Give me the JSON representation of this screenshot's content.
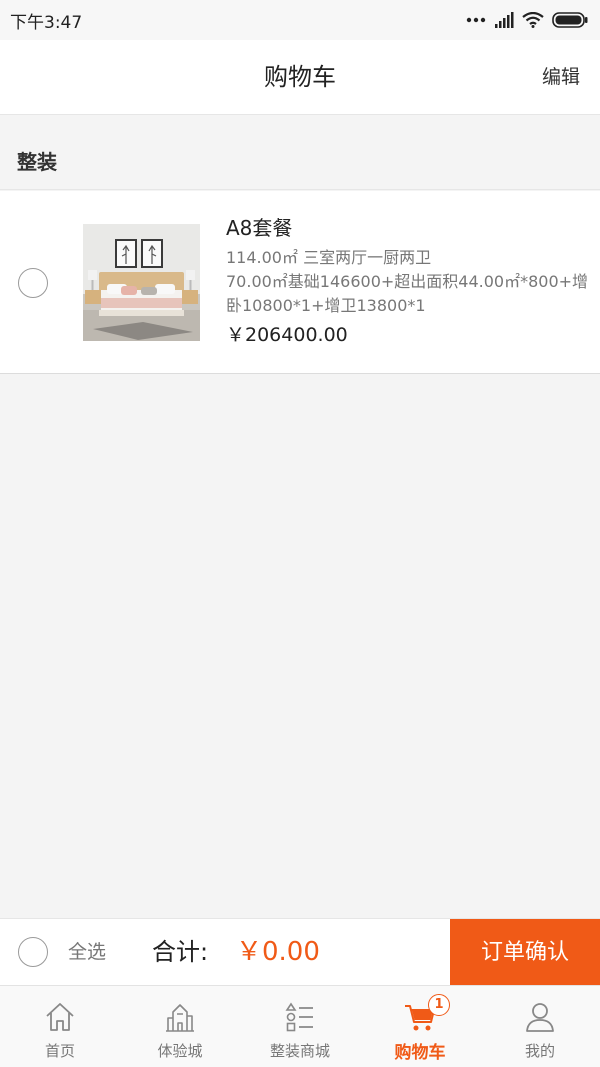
{
  "status_bar": {
    "time": "下午3:47",
    "icons": [
      "signal-dots-icon",
      "cellular-signal-icon",
      "wifi-icon",
      "battery-icon"
    ]
  },
  "header": {
    "title": "购物车",
    "edit_label": "编辑"
  },
  "section": {
    "title": "整装"
  },
  "cart_items": [
    {
      "name": "A8套餐",
      "spec": "114.00㎡ 三室两厅一厨两卫",
      "desc": "70.00㎡基础146600+超出面积44.00㎡*800+增卧10800*1+增卫13800*1",
      "price": "￥206400.00",
      "selected": false,
      "image": "bedroom-photo"
    }
  ],
  "bottom_bar": {
    "select_all_label": "全选",
    "total_label": "合计:",
    "total_value": "￥0.00",
    "confirm_label": "订单确认"
  },
  "tab_bar": {
    "items": [
      {
        "label": "首页",
        "icon": "home-icon"
      },
      {
        "label": "体验城",
        "icon": "city-building-icon"
      },
      {
        "label": "整装商城",
        "icon": "category-list-icon"
      },
      {
        "label": "购物车",
        "icon": "shopping-cart-icon",
        "badge": "1",
        "active": true
      },
      {
        "label": "我的",
        "icon": "user-profile-icon"
      }
    ]
  },
  "colors": {
    "accent": "#f05a17",
    "background": "#f4f4f4"
  }
}
